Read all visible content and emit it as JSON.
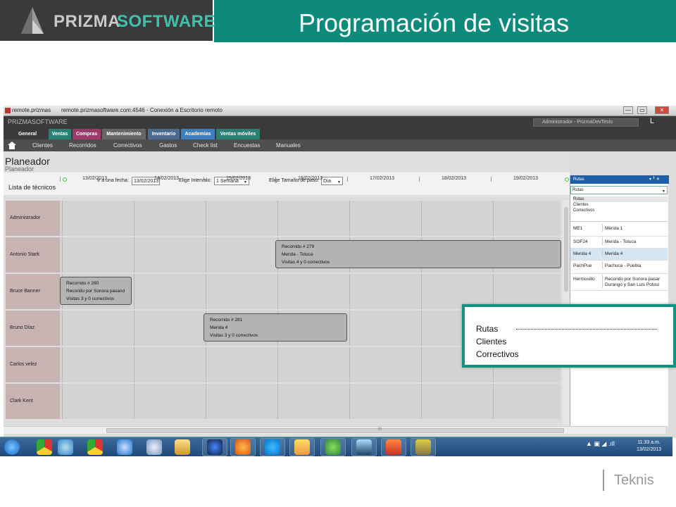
{
  "slide": {
    "logo_part1": "PRIZMA",
    "logo_part2": "SOFTWARE",
    "title": "Programación de visitas",
    "footer": "Teknis"
  },
  "rdp": {
    "tab_label": "remote.prizmas",
    "title": "remote.prizmasoftware.com:4546 - Conexión a Escritorio remoto",
    "buttons": [
      "—",
      "▭",
      "✕"
    ]
  },
  "app": {
    "logo": "PRIZMASOFTWARE",
    "user": "Administrador - PrizmaDevTests",
    "window_controls": "L _ x",
    "main_tabs": [
      {
        "label": "General",
        "color": "#3a3a3a"
      },
      {
        "label": "Ventas",
        "color": "#2c7f73"
      },
      {
        "label": "Compras",
        "color": "#9b3b6a"
      },
      {
        "label": "Mantenimiento",
        "color": "#666666"
      },
      {
        "label": "Inventario",
        "color": "#4a6b8f"
      },
      {
        "label": "Academias",
        "color": "#3e7fbf"
      },
      {
        "label": "Ventas móviles",
        "color": "#2c7f73"
      }
    ],
    "sub_items": [
      "Clientes",
      "Recorridos",
      "Correctivos",
      "Gastos",
      "Check list",
      "Encuestas",
      "Manuales"
    ]
  },
  "planner": {
    "title": "Planeador",
    "subtitle": "Planeador",
    "dates": [
      "13/02/2013",
      "14/02/2013",
      "15/02/2013",
      "16/02/2013",
      "17/02/2013",
      "18/02/2013",
      "19/02/2013"
    ],
    "list_label": "Lista de técnicos",
    "goto_label": "Ir a una fecha:",
    "goto_value": "13/02/2013",
    "interval_label": "Elige Intervalo:",
    "interval_value": "1 Semana",
    "step_label": "Elige Tamaño de paso:",
    "step_value": "Día",
    "technicians": [
      "Administrador",
      "Antonio Stark",
      "Bruce Banner",
      "Bruno Díaz",
      "Carlos velez",
      "Clark Kent"
    ],
    "blocks": [
      {
        "lines": [
          "Recorrido # 279",
          "Merida - Toluca",
          "Visitas 4 y 0 correctivos"
        ]
      },
      {
        "lines": [
          "Recorrido # 280",
          "Recorido por Sonora pasand",
          "Visitas 3 y 0 correctivos"
        ]
      },
      {
        "lines": [
          "Recorrido # 281",
          "Merida 4",
          "Visitas 3 y 0 correctivos"
        ]
      }
    ],
    "scroll_marker": "III"
  },
  "rutas_panel": {
    "header": "Rutas",
    "header_controls": "▾ ╹ ✕",
    "selected": "Rutas",
    "options": [
      "Rutas",
      "Clientes",
      "Correctivos"
    ],
    "rows": [
      {
        "code": "ME1",
        "name": "Mérida 1"
      },
      {
        "code": "SOF24",
        "name": "Merida - Toluca"
      },
      {
        "code": "Merida 4",
        "name": "Merida 4"
      },
      {
        "code": "PachPue",
        "name": "Pachuca - Puebla"
      },
      {
        "code": "Hermosillo",
        "name": "Recorido por Sonora pasar Durango y San Luis Potosí"
      }
    ]
  },
  "zoom": {
    "items": [
      "Rutas",
      "Clientes",
      "Correctivos"
    ]
  },
  "taskbar": {
    "icons": [
      "start-orb-icon",
      "chrome-icon",
      "windows-icon",
      "chrome-icon",
      "ie-icon",
      "search-icon",
      "explorer-icon",
      "network-icon",
      "firefox-icon",
      "skype-icon",
      "mail-icon",
      "utorrent-icon",
      "remote-desktop-icon",
      "powerpoint-icon",
      "fireworks-icon"
    ],
    "time": "11:33 a.m.",
    "date": "13/02/2013"
  }
}
